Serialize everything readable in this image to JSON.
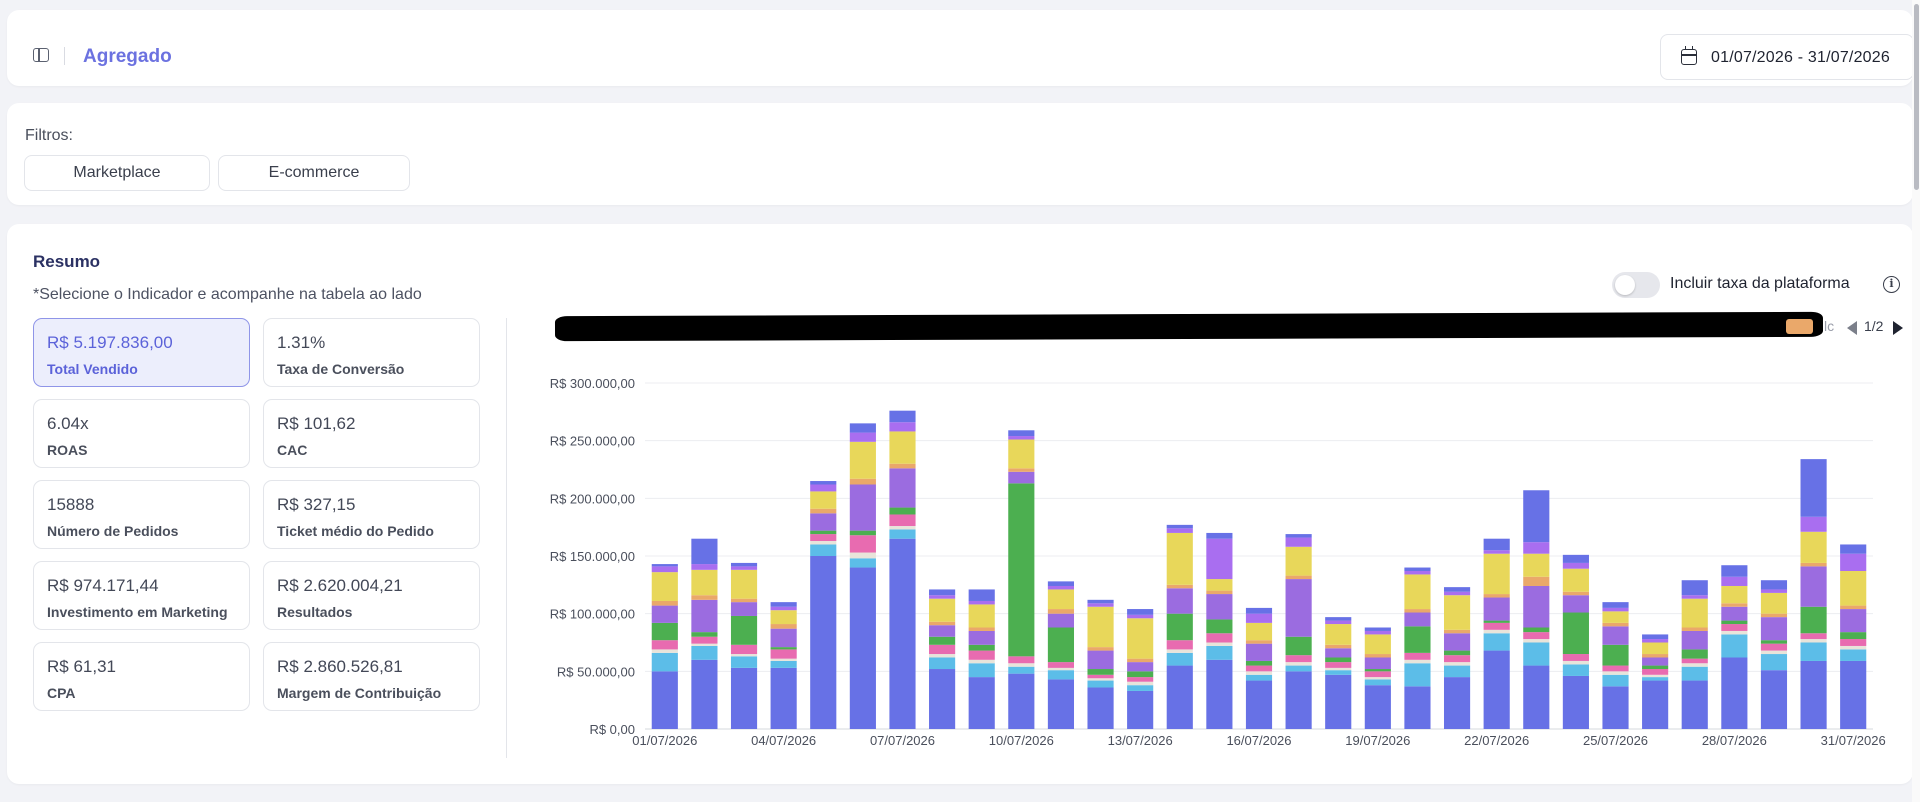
{
  "header": {
    "title": "Agregado",
    "date_range": "01/07/2026 - 31/07/2026",
    "icons": [
      "sidebar-toggle-icon",
      "calendar-icon"
    ]
  },
  "filters": {
    "label": "Filtros:",
    "chips": [
      "Marketplace",
      "E-commerce"
    ]
  },
  "summary": {
    "title": "Resumo",
    "hint": "*Selecione o Indicador e acompanhe na tabela ao lado",
    "toggle_label": "Incluir taxa da plataforma",
    "toggle_on": false,
    "kpis": [
      {
        "value": "R$ 5.197.836,00",
        "label": "Total Vendido",
        "active": true
      },
      {
        "value": "1.31%",
        "label": "Taxa de Conversão",
        "active": false
      },
      {
        "value": "6.04x",
        "label": "ROAS",
        "active": false
      },
      {
        "value": "R$ 101,62",
        "label": "CAC",
        "active": false
      },
      {
        "value": "15888",
        "label": "Número de Pedidos",
        "active": false
      },
      {
        "value": "R$ 327,15",
        "label": "Ticket médio do Pedido",
        "active": false
      },
      {
        "value": "R$ 974.171,44",
        "label": "Investimento em Marketing",
        "active": false
      },
      {
        "value": "R$ 2.620.004,21",
        "label": "Resultados",
        "active": false
      },
      {
        "value": "R$ 61,31",
        "label": "CPA",
        "active": false
      },
      {
        "value": "R$ 2.860.526,81",
        "label": "Margem de Contribuição",
        "active": false
      }
    ]
  },
  "legend": {
    "truncated_text": "lc",
    "page": "1/2",
    "visible_swatch_color": "#eaa86a"
  },
  "chart_data": {
    "type": "bar",
    "stacked": true,
    "ylim": [
      0,
      300000
    ],
    "yticks": [
      0,
      50000,
      100000,
      150000,
      200000,
      250000,
      300000
    ],
    "ytick_labels": [
      "R$ 0,00",
      "R$ 50.000,00",
      "R$ 100.000,00",
      "R$ 150.000,00",
      "R$ 200.000,00",
      "R$ 250.000,00",
      "R$ 300.000,00"
    ],
    "xtick_labels": [
      "01/07/2026",
      "04/07/2026",
      "07/07/2026",
      "10/07/2026",
      "13/07/2026",
      "16/07/2026",
      "19/07/2026",
      "22/07/2026",
      "25/07/2026",
      "28/07/2026",
      "31/07/2026"
    ],
    "xtick_indices": [
      0,
      3,
      6,
      9,
      12,
      15,
      18,
      21,
      24,
      27,
      30
    ],
    "grid": true,
    "legend_position": "top-right",
    "colors": [
      "#6771e6",
      "#5cbde8",
      "#e8e4da",
      "#e86bb0",
      "#4caf50",
      "#9b6ce0",
      "#eaa86a",
      "#e8d75a",
      "#a96ef0"
    ],
    "categories": [
      "01/07/2026",
      "02/07/2026",
      "03/07/2026",
      "04/07/2026",
      "05/07/2026",
      "06/07/2026",
      "07/07/2026",
      "08/07/2026",
      "09/07/2026",
      "10/07/2026",
      "11/07/2026",
      "12/07/2026",
      "13/07/2026",
      "14/07/2026",
      "15/07/2026",
      "16/07/2026",
      "17/07/2026",
      "18/07/2026",
      "19/07/2026",
      "20/07/2026",
      "21/07/2026",
      "22/07/2026",
      "23/07/2026",
      "24/07/2026",
      "25/07/2026",
      "26/07/2026",
      "27/07/2026",
      "28/07/2026",
      "29/07/2026",
      "30/07/2026",
      "31/07/2026"
    ],
    "series": [
      {
        "values": [
          50000,
          60000,
          53000,
          53000,
          150000,
          140000,
          165000,
          52000,
          45000,
          48000,
          43000,
          36000,
          33000,
          55000,
          60000,
          42000,
          50000,
          47000,
          38000,
          37000,
          45000,
          68000,
          55000,
          46000,
          37000,
          42000,
          42000,
          62000,
          51000,
          59000,
          59000
        ]
      },
      {
        "values": [
          16000,
          12000,
          10000,
          6000,
          10000,
          8000,
          8000,
          10000,
          12000,
          6000,
          8000,
          6000,
          5000,
          11000,
          12000,
          5000,
          5000,
          4000,
          5000,
          20000,
          10000,
          15000,
          20000,
          10000,
          10000,
          3000,
          12000,
          20000,
          14000,
          16000,
          10000
        ]
      },
      {
        "values": [
          3000,
          2000,
          2000,
          2000,
          3000,
          5000,
          3000,
          3000,
          3000,
          3000,
          2000,
          2000,
          3000,
          3000,
          3000,
          3000,
          3000,
          2000,
          2000,
          3000,
          3000,
          3000,
          3000,
          3000,
          3000,
          2000,
          3000,
          3000,
          3000,
          3000,
          3000
        ]
      },
      {
        "values": [
          8000,
          6000,
          8000,
          8000,
          6000,
          15000,
          10000,
          8000,
          8000,
          6000,
          5000,
          3000,
          4000,
          8000,
          8000,
          5000,
          6000,
          5000,
          5000,
          6000,
          6000,
          6000,
          6000,
          6000,
          5000,
          5000,
          4000,
          6000,
          6000,
          5000,
          6000
        ]
      },
      {
        "values": [
          15000,
          4000,
          25000,
          2000,
          3000,
          4000,
          6000,
          7000,
          5000,
          150000,
          30000,
          5000,
          5000,
          23000,
          12000,
          4000,
          16000,
          4000,
          2000,
          23000,
          4000,
          2000,
          4000,
          36000,
          18000,
          3000,
          8000,
          3000,
          3000,
          23000,
          6000
        ]
      },
      {
        "values": [
          15000,
          28000,
          12000,
          16000,
          15000,
          40000,
          34000,
          10000,
          12000,
          10000,
          12000,
          16000,
          8000,
          22000,
          22000,
          15000,
          50000,
          8000,
          10000,
          12000,
          15000,
          20000,
          36000,
          15000,
          16000,
          7000,
          16000,
          12000,
          20000,
          35000,
          20000
        ]
      },
      {
        "values": [
          4000,
          4000,
          3000,
          4000,
          4000,
          5000,
          4000,
          3000,
          3000,
          3000,
          4000,
          3000,
          3000,
          3000,
          3000,
          3000,
          3000,
          3000,
          3000,
          3000,
          3000,
          3000,
          8000,
          3000,
          3000,
          3000,
          3000,
          3000,
          3000,
          3000,
          3000
        ]
      },
      {
        "values": [
          25000,
          22000,
          25000,
          12000,
          15000,
          32000,
          28000,
          20000,
          20000,
          25000,
          17000,
          35000,
          35000,
          45000,
          10000,
          15000,
          25000,
          18000,
          17000,
          30000,
          30000,
          35000,
          20000,
          20000,
          10000,
          10000,
          25000,
          15000,
          18000,
          27000,
          30000
        ]
      },
      {
        "values": [
          5000,
          5000,
          3000,
          3000,
          6000,
          8000,
          8000,
          3000,
          3000,
          3000,
          3000,
          3000,
          3000,
          4000,
          35000,
          8000,
          8000,
          3000,
          3000,
          3000,
          3000,
          3000,
          10000,
          5000,
          3000,
          3000,
          3000,
          8000,
          3000,
          13000,
          15000
        ]
      },
      {
        "values": [
          2000,
          22000,
          3000,
          4000,
          3000,
          8000,
          10000,
          5000,
          10000,
          5000,
          4000,
          3000,
          5000,
          3000,
          5000,
          5000,
          3000,
          3000,
          3000,
          3000,
          4000,
          10000,
          45000,
          7000,
          5000,
          4000,
          13000,
          10000,
          8000,
          50000,
          8000
        ]
      }
    ]
  }
}
